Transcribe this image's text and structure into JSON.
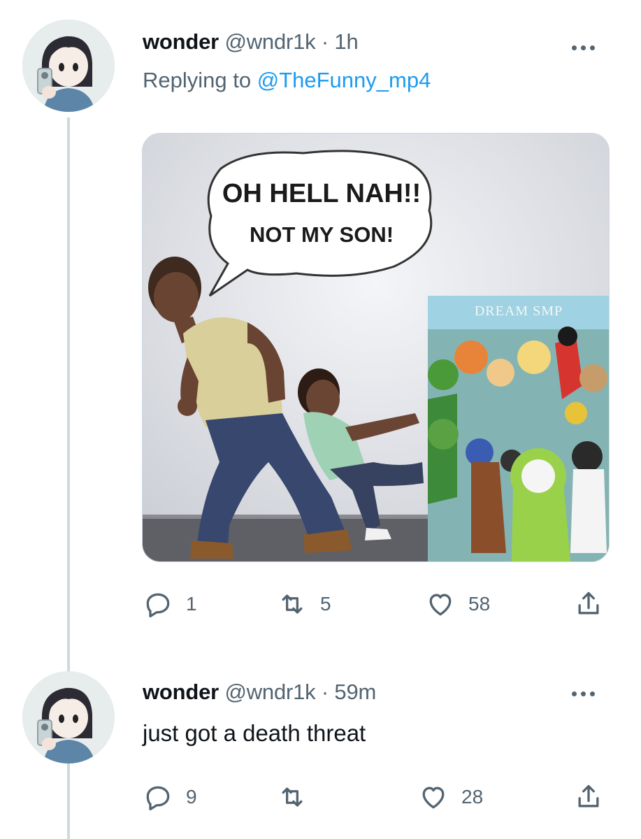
{
  "tweets": [
    {
      "display_name": "wonder",
      "handle_time": "@wndr1k · 1h",
      "replying_prefix": "Replying to",
      "replying_handle": "@TheFunny_mp4",
      "media": {
        "speech_line1": "OH HELL NAH!!",
        "speech_line2": "NOT MY SON!",
        "poster_title": "DREAM SMP"
      },
      "actions": {
        "replies": "1",
        "retweets": "5",
        "likes": "58"
      }
    },
    {
      "display_name": "wonder",
      "handle_time": "@wndr1k · 59m",
      "text": "just got a death threat",
      "actions": {
        "replies": "9",
        "retweets": "",
        "likes": "28"
      }
    }
  ],
  "icons": [
    "reply-icon",
    "retweet-icon",
    "like-icon",
    "share-icon",
    "more-icon"
  ],
  "colors": {
    "link": "#1d9bf0",
    "secondary": "#536471",
    "primary_text": "#0f1419",
    "thread_line": "#cfd9de"
  }
}
